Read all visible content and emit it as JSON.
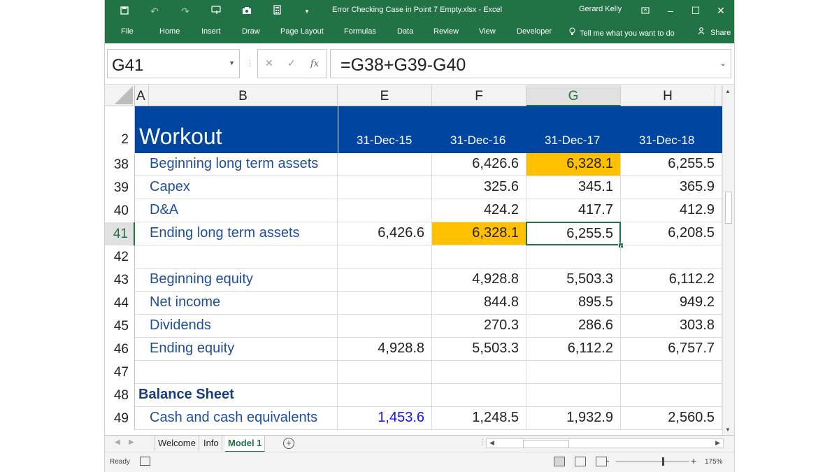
{
  "window": {
    "title": "Error Checking Case in Point 7 Empty.xlsx  -  Excel",
    "user": "Gerard Kelly"
  },
  "ribbon": {
    "tabs": [
      "File",
      "Home",
      "Insert",
      "Draw",
      "Page Layout",
      "Formulas",
      "Data",
      "Review",
      "View",
      "Developer"
    ],
    "tell_me": "Tell me what you want to do",
    "share": "Share"
  },
  "formula_bar": {
    "name_box": "G41",
    "fx": "fx",
    "formula": "=G38+G39-G40"
  },
  "columns": [
    "A",
    "B",
    "E",
    "F",
    "G",
    "H"
  ],
  "header_row": {
    "row": "2",
    "title": "Workout",
    "dates": [
      "31-Dec-15",
      "31-Dec-16",
      "31-Dec-17",
      "31-Dec-18"
    ]
  },
  "rows": [
    {
      "num": "38",
      "label": "Beginning long term assets",
      "E": "",
      "F": "6,426.6",
      "G": "6,328.1",
      "H": "6,255.5"
    },
    {
      "num": "39",
      "label": "Capex",
      "E": "",
      "F": "325.6",
      "G": "345.1",
      "H": "365.9"
    },
    {
      "num": "40",
      "label": "D&A",
      "E": "",
      "F": "424.2",
      "G": "417.7",
      "H": "412.9"
    },
    {
      "num": "41",
      "label": "Ending long term assets",
      "E": "6,426.6",
      "F": "6,328.1",
      "G": "6,255.5",
      "H": "6,208.5"
    },
    {
      "num": "42",
      "label": "",
      "E": "",
      "F": "",
      "G": "",
      "H": ""
    },
    {
      "num": "43",
      "label": "Beginning equity",
      "E": "",
      "F": "4,928.8",
      "G": "5,503.3",
      "H": "6,112.2"
    },
    {
      "num": "44",
      "label": "Net income",
      "E": "",
      "F": "844.8",
      "G": "895.5",
      "H": "949.2"
    },
    {
      "num": "45",
      "label": "Dividends",
      "E": "",
      "F": "270.3",
      "G": "286.6",
      "H": "303.8"
    },
    {
      "num": "46",
      "label": "Ending equity",
      "E": "4,928.8",
      "F": "5,503.3",
      "G": "6,112.2",
      "H": "6,757.7"
    },
    {
      "num": "47",
      "label": "",
      "E": "",
      "F": "",
      "G": "",
      "H": ""
    },
    {
      "num": "48",
      "label": "Balance Sheet",
      "E": "",
      "F": "",
      "G": "",
      "H": ""
    },
    {
      "num": "49",
      "label": "Cash and cash equivalents",
      "E": "1,453.6",
      "F": "1,248.5",
      "G": "1,932.9",
      "H": "2,560.5"
    }
  ],
  "sheets": {
    "tabs": [
      "Welcome",
      "Info",
      "Model 1"
    ],
    "active": "Model 1"
  },
  "status": {
    "mode": "Ready",
    "zoom": "175%"
  },
  "colors": {
    "excel_green": "#217346",
    "header_band": "#0046a0",
    "highlight": "#ffc000",
    "label_blue": "#1f4e9c",
    "input_blue": "#1414e6"
  },
  "icons": [
    "save-icon",
    "undo-icon",
    "redo-icon",
    "touch-mode-icon",
    "camera-icon",
    "calculator-icon",
    "customize-qat-icon",
    "ribbon-display-icon",
    "minimize-icon",
    "maximize-icon",
    "close-icon",
    "lightbulb-icon",
    "share-icon"
  ]
}
